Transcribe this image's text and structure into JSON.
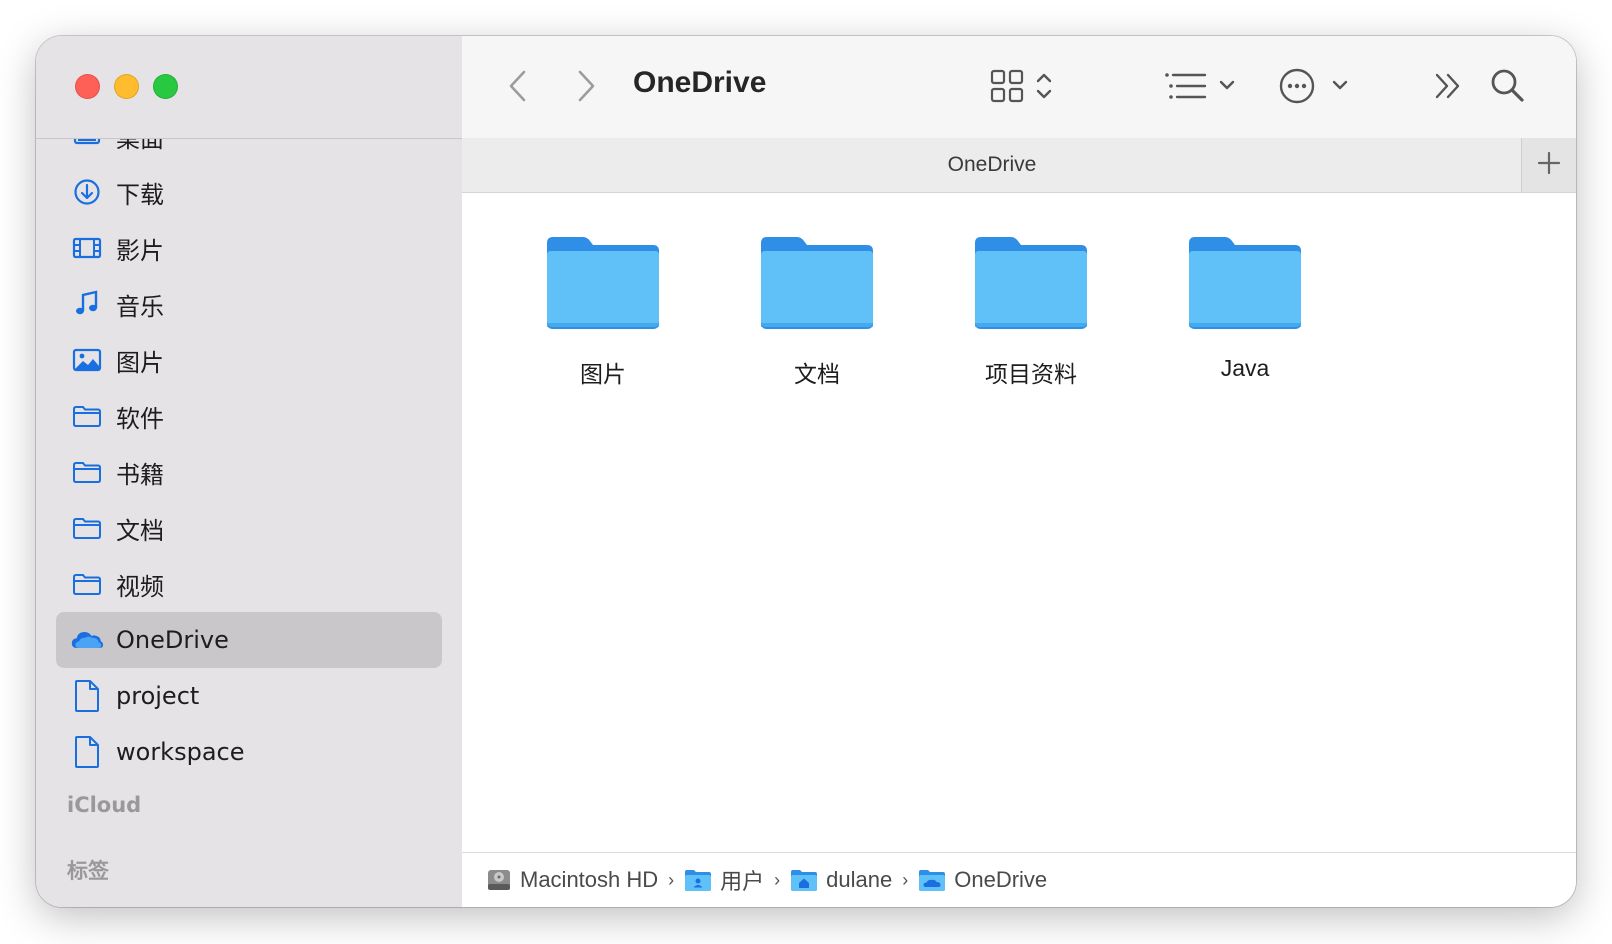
{
  "window": {
    "title": "OneDrive"
  },
  "colors": {
    "sidebar_bg": "#e6e3e6",
    "selected_bg": "#cac7ca",
    "accent_blue": "#1a6fe0",
    "folder_blue": "#5fc1f8",
    "folder_tab": "#2f8fe6",
    "close": "#fe5f57",
    "minimize": "#febc2e",
    "maximize": "#28c840"
  },
  "sidebar": {
    "items": [
      {
        "label": "桌面",
        "icon": "desktop-icon"
      },
      {
        "label": "下载",
        "icon": "download-icon"
      },
      {
        "label": "影片",
        "icon": "film-icon"
      },
      {
        "label": "音乐",
        "icon": "music-note-icon"
      },
      {
        "label": "图片",
        "icon": "photo-icon"
      },
      {
        "label": "软件",
        "icon": "folder-icon"
      },
      {
        "label": "书籍",
        "icon": "folder-icon"
      },
      {
        "label": "文档",
        "icon": "folder-icon"
      },
      {
        "label": "视频",
        "icon": "folder-icon"
      },
      {
        "label": "OneDrive",
        "icon": "cloud-icon",
        "selected": true
      },
      {
        "label": "project",
        "icon": "document-icon"
      },
      {
        "label": "workspace",
        "icon": "document-icon"
      }
    ],
    "sections": {
      "icloud": "iCloud",
      "tags": "标签"
    }
  },
  "toolbar": {
    "back_icon": "chevron-left-icon",
    "forward_icon": "chevron-right-icon",
    "view_icon": "grid-view-icon",
    "group_icon": "list-group-icon",
    "action_icon": "ellipsis-circle-icon",
    "more_icon": "double-chevron-right-icon",
    "search_icon": "search-icon"
  },
  "tabbar": {
    "tab_label": "OneDrive",
    "add_icon": "plus-icon"
  },
  "files": [
    {
      "name": "图片",
      "icon": "folder-icon"
    },
    {
      "name": "文档",
      "icon": "folder-icon"
    },
    {
      "name": "项目资料",
      "icon": "folder-icon"
    },
    {
      "name": "Java",
      "icon": "folder-icon"
    }
  ],
  "pathbar": {
    "crumbs": [
      {
        "label": "Macintosh HD",
        "icon": "hard-drive-icon"
      },
      {
        "label": "用户",
        "icon": "users-folder-icon"
      },
      {
        "label": "dulane",
        "icon": "home-folder-icon"
      },
      {
        "label": "OneDrive",
        "icon": "cloud-folder-icon"
      }
    ]
  }
}
